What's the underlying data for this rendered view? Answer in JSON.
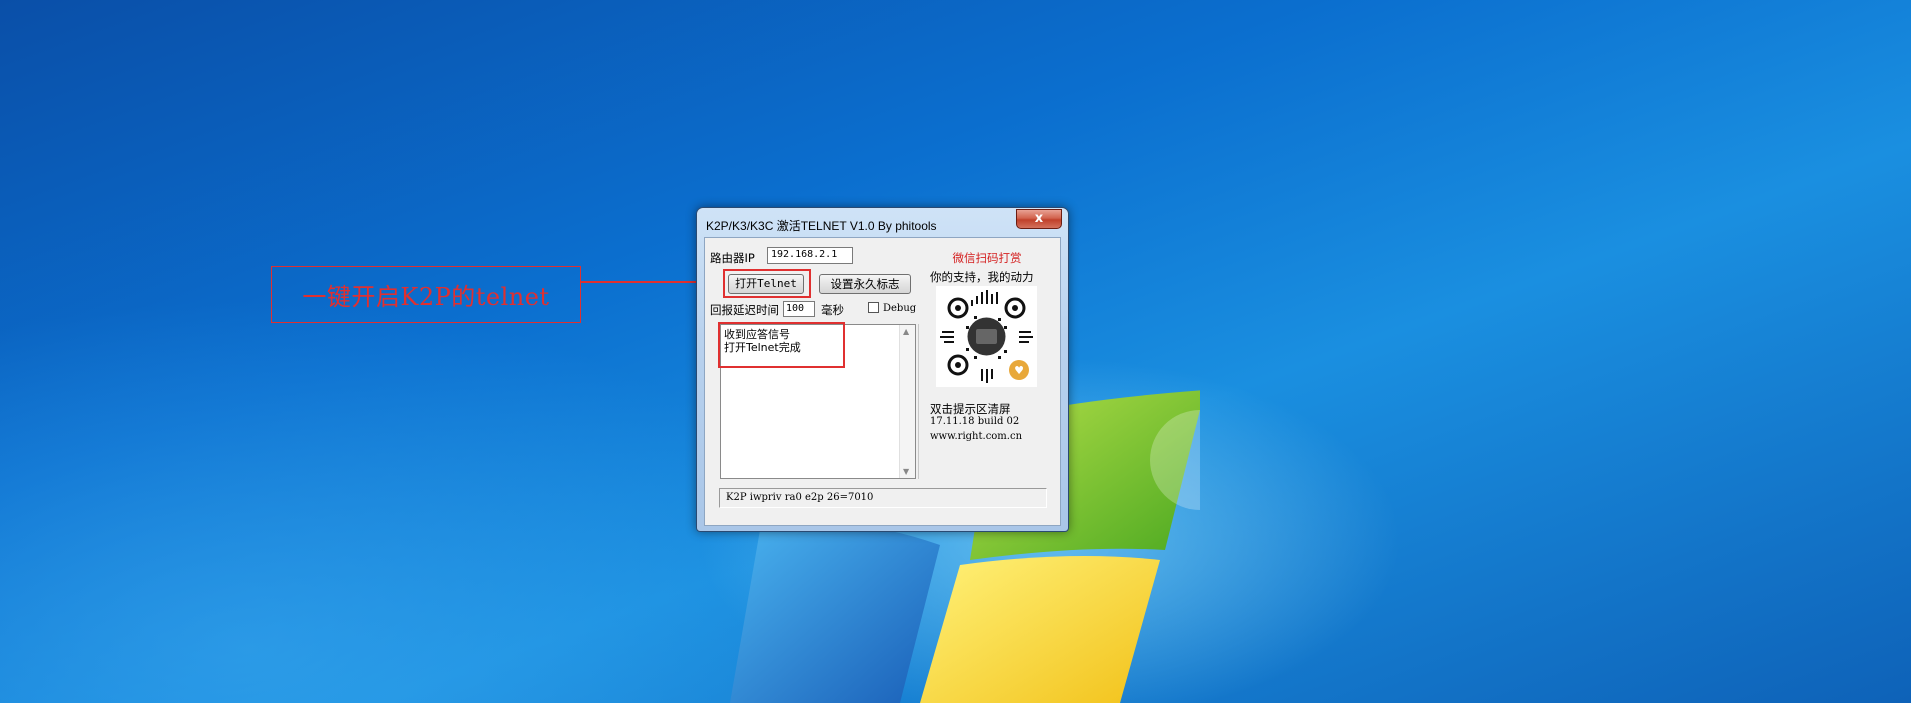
{
  "annotation": {
    "text": "一键开启K2P的telnet"
  },
  "window": {
    "title": "K2P/K3/K3C 激活TELNET V1.0 By phitools",
    "close_symbol": "x",
    "router_ip_label": "路由器IP",
    "router_ip_value": "192.168.2.1",
    "open_telnet_button": "打开Telnet",
    "permanent_flag_button": "设置永久标志",
    "delay_label": "回报延迟时间",
    "delay_value": "100",
    "delay_unit": "毫秒",
    "debug_label": "Debug",
    "debug_checked": false,
    "log_lines": [
      "收到应答信号",
      "打开Telnet完成"
    ],
    "sidebar": {
      "title": "微信扫码打赏",
      "subtitle": "你的支持，我的动力",
      "clear_hint": "双击提示区清屏",
      "version": "17.11.18 build 02",
      "website": "www.right.com.cn"
    },
    "status_text": "K2P iwpriv ra0 e2p 26=7010"
  },
  "colors": {
    "annotation_red": "#e03030",
    "sidebar_title_red": "#d42020"
  },
  "icons": [
    "close-icon",
    "qr-code-icon",
    "windows-logo-icon",
    "scroll-up-icon",
    "scroll-down-icon"
  ]
}
